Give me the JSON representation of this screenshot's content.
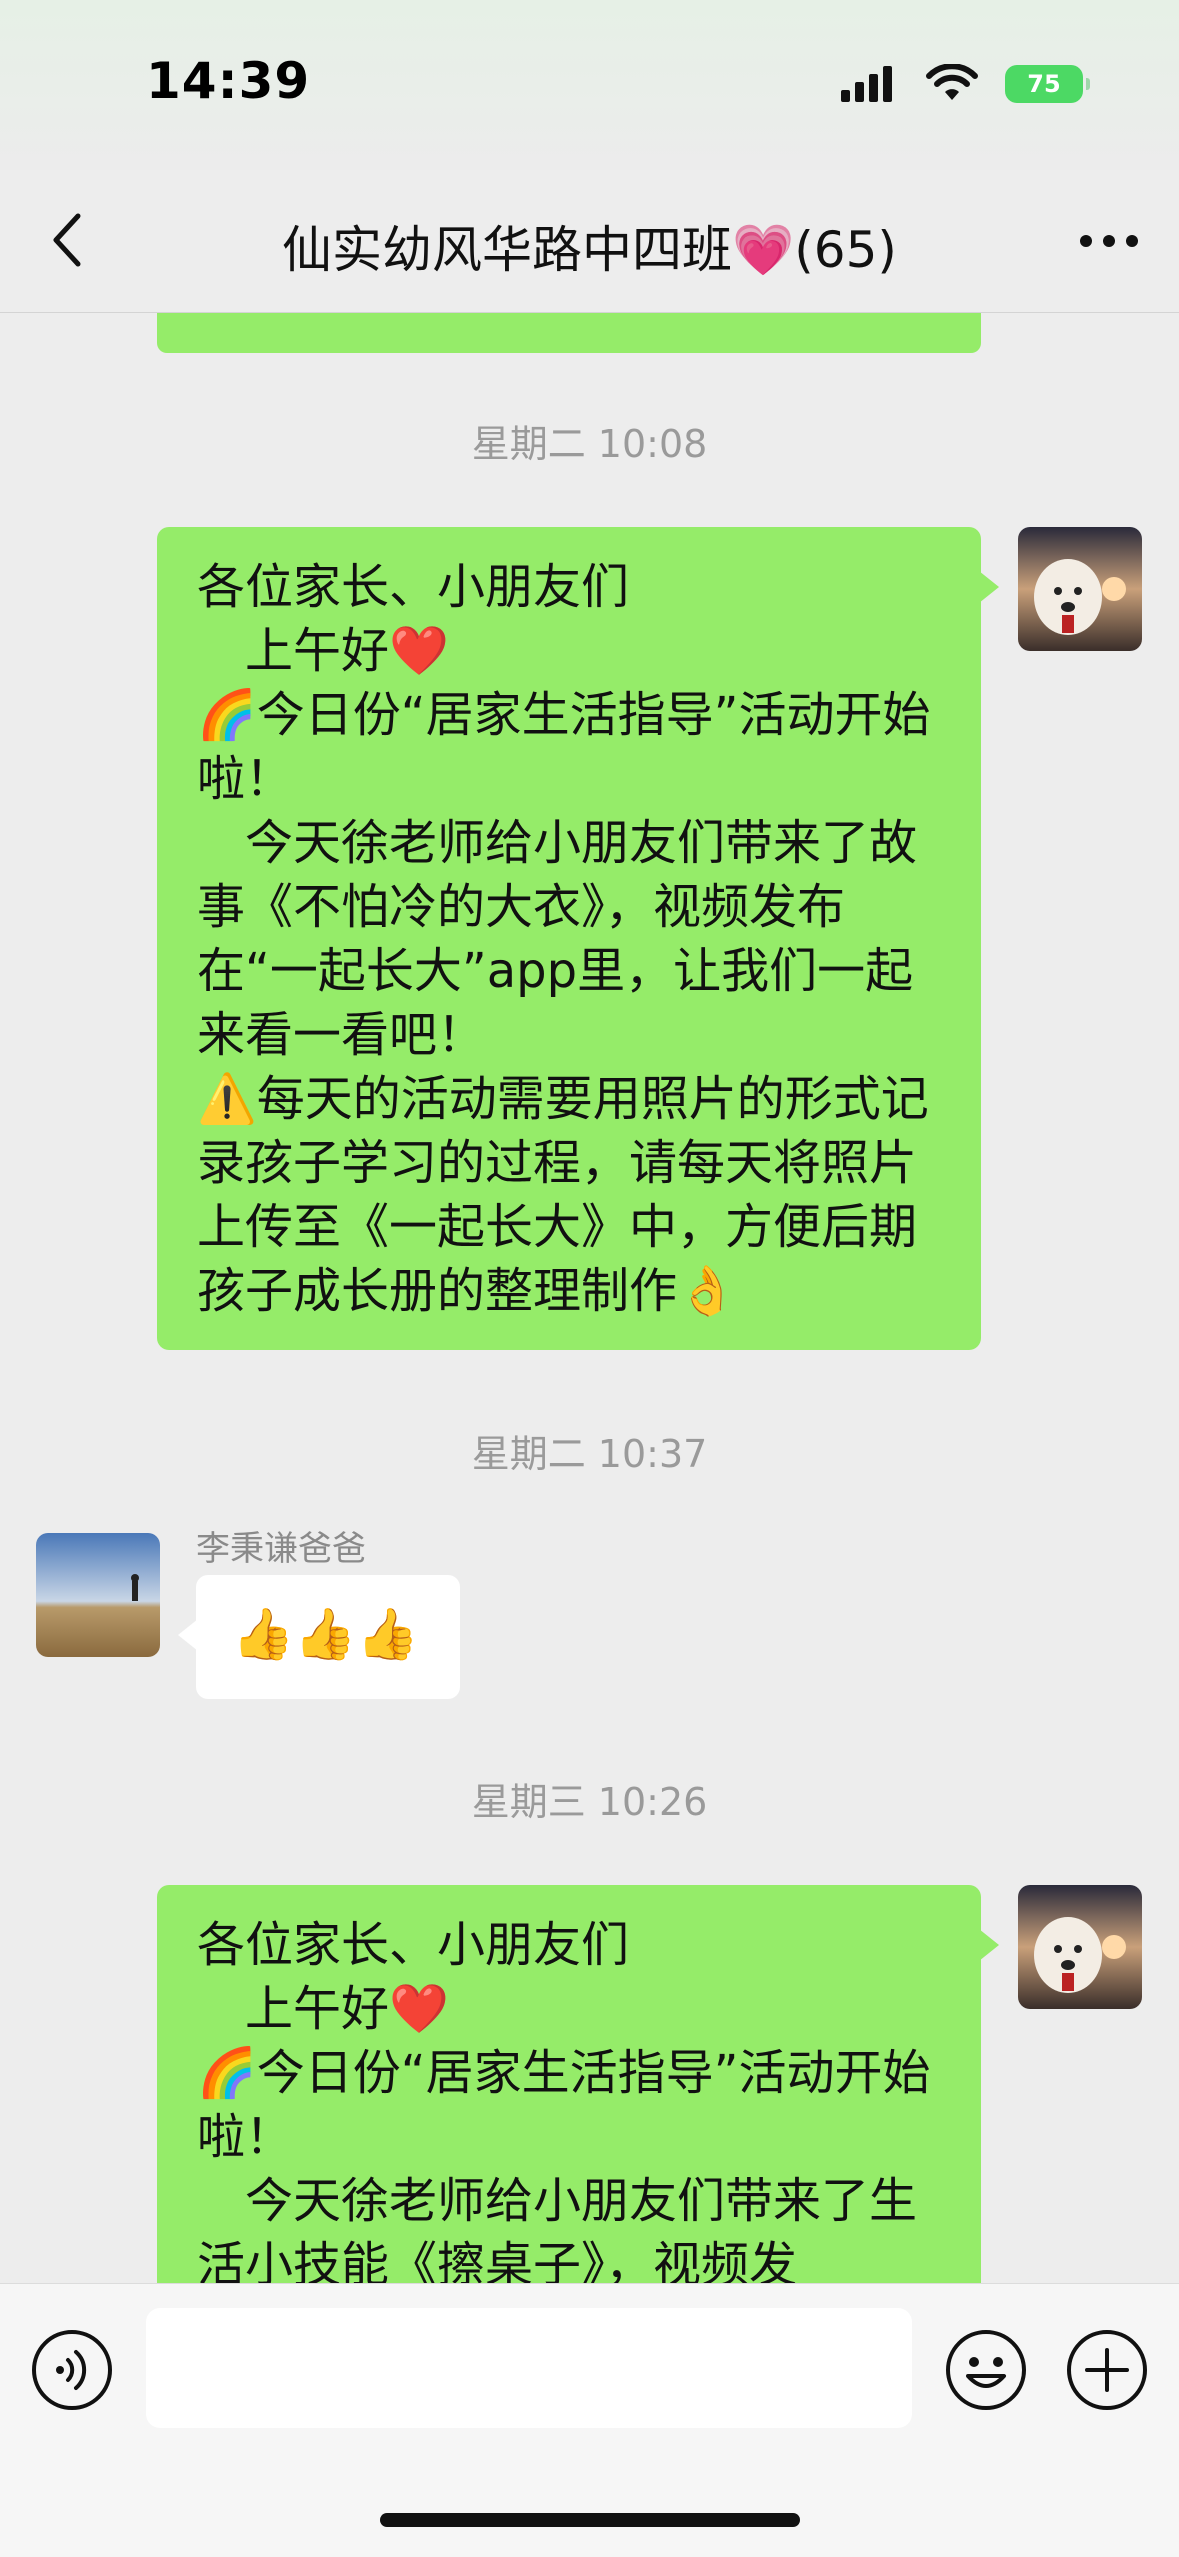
{
  "status_bar": {
    "time": "14:39",
    "battery": "75"
  },
  "nav": {
    "title": "仙实幼风华路中四班💗(65)"
  },
  "messages": [
    {
      "timestamp": "星期二 10:08",
      "text": "各位家长、小朋友们\n　上午好❤️\n🌈今日份“居家生活指导”活动开始啦！\n　今天徐老师给小朋友们带来了故事《不怕冷的大衣》，视频发布在“一起长大”app里，让我们一起来看一看吧！\n⚠️每天的活动需要用照片的形式记录孩子学习的过程，请每天将照片上传至《一起长大》中，方便后期孩子成长册的整理制作👌"
    },
    {
      "timestamp": "星期二 10:37",
      "sender": "李秉谦爸爸",
      "text": "👍👍👍"
    },
    {
      "timestamp": "星期三 10:26",
      "text": "各位家长、小朋友们\n　上午好❤️\n🌈今日份“居家生活指导”活动开始啦！\n　今天徐老师给小朋友们带来了生活小技能《擦桌子》，视频发"
    }
  ],
  "input": {
    "value": ""
  },
  "colors": {
    "outgoing_bubble": "#95ec69",
    "incoming_bubble": "#ffffff",
    "background": "#ededed"
  },
  "icons": [
    "back-icon",
    "more-icon",
    "voice-icon",
    "emoji-icon",
    "plus-icon",
    "signal-icon",
    "wifi-icon"
  ]
}
